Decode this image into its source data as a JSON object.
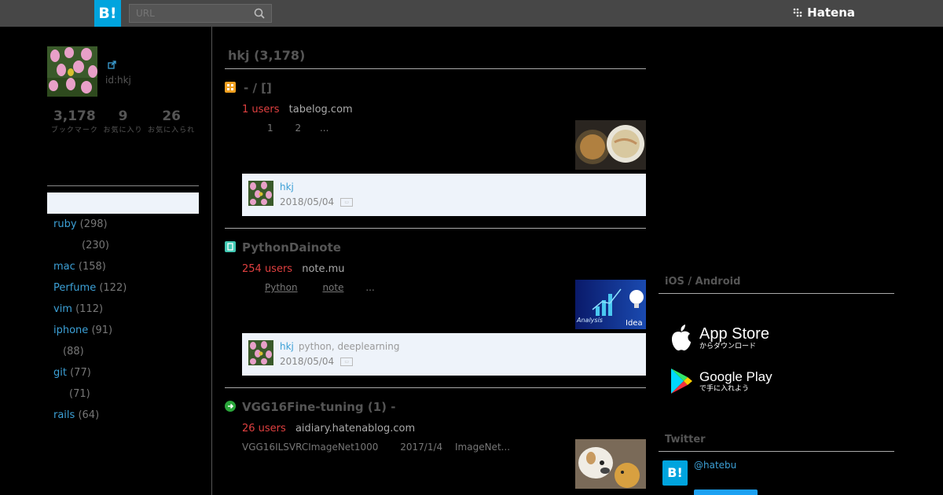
{
  "topbar": {
    "logo_text": "B!",
    "search_placeholder": "URL",
    "brand": "Hatena"
  },
  "profile": {
    "user_id": "id:hkj",
    "stats": [
      {
        "value": "3,178",
        "label": "ブックマーク"
      },
      {
        "value": "9",
        "label": "お気に入り"
      },
      {
        "value": "26",
        "label": "お気に入られ"
      }
    ]
  },
  "tags": [
    {
      "name": "ruby",
      "count": "(298)"
    },
    {
      "name": "",
      "count": "(230)"
    },
    {
      "name": "mac",
      "count": "(158)"
    },
    {
      "name": "Perfume",
      "count": "(122)"
    },
    {
      "name": "vim",
      "count": "(112)"
    },
    {
      "name": "iphone",
      "count": "(91)"
    },
    {
      "name": "",
      "count": "(88)"
    },
    {
      "name": "git",
      "count": "(77)"
    },
    {
      "name": "",
      "count": "(71)"
    },
    {
      "name": "rails",
      "count": "(64)"
    }
  ],
  "main": {
    "title": "hkj (3,178)",
    "entries": [
      {
        "title": " - / []",
        "users": "1 users",
        "domain": "tabelog.com",
        "desc": [
          "1",
          "2",
          "..."
        ],
        "bookmark": {
          "user": "hkj",
          "comment": "",
          "date": "2018/05/04"
        }
      },
      {
        "title": "PythonDainote",
        "users": "254 users",
        "domain": "note.mu",
        "desc": [
          "Python",
          "note",
          "..."
        ],
        "bookmark": {
          "user": "hkj",
          "comment": "python, deeplearning",
          "date": "2018/05/04"
        }
      },
      {
        "title": "VGG16Fine-tuning (1) -",
        "users": "26 users",
        "domain": "aidiary.hatenablog.com",
        "desc": [
          "VGG16ILSVRC",
          "ImageNet1000",
          "2017/1/4",
          "ImageNet..."
        ]
      }
    ],
    "thumb2_texts": [
      "Analysis",
      "Idea"
    ]
  },
  "right": {
    "apps_title": "iOS / Android",
    "appstore_name": "App Store",
    "appstore_sub": "からダウンロード",
    "gplay_name": "Google Play",
    "gplay_sub": "で手に入れよう",
    "twitter_title": "Twitter",
    "twitter_handle": "@hatebu",
    "twitter_logo": "B!"
  },
  "colors": {
    "accent": "#00a4de",
    "users_red": "#e04040",
    "link_blue": "#3ca0d6",
    "box_bg": "#eef3fa"
  }
}
